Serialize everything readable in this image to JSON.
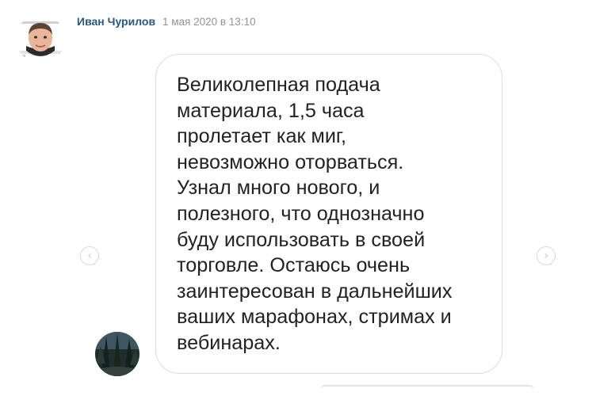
{
  "post": {
    "author_name": "Иван Чурилов",
    "date": "1 мая 2020 в 13:10",
    "author_avatar_icon": "person-photo-icon"
  },
  "review": {
    "message": "Великолепная подача\nматериала, 1,5 часа\nпролетает как миг,\nневозможно оторваться.\nУзнал  много нового, и\nполезного, что однозначно\nбуду использовать в своей\nторговле. Остаюсь очень\nзаинтересован в дальнейших\nваших марафонах, стримах и\nвебинарах.",
    "sender_avatar_icon": "forest-photo-icon"
  },
  "navigation": {
    "prev_glyph": "‹",
    "next_glyph": "›"
  },
  "colors": {
    "author_name": "#2a5885",
    "date": "#939393",
    "message_text": "#222222",
    "bubble_border": "#dcdcdc"
  }
}
